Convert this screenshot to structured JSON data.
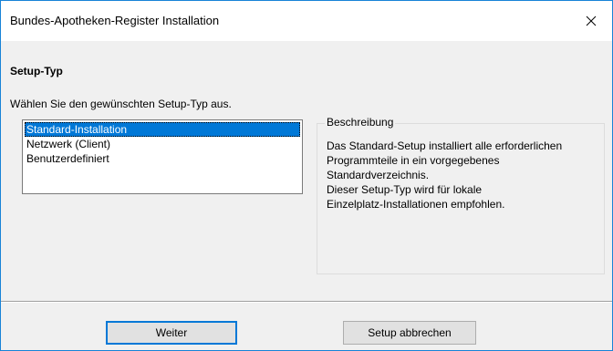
{
  "window": {
    "title": "Bundes-Apotheken-Register Installation"
  },
  "page": {
    "heading": "Setup-Typ",
    "instruction": "Wählen Sie den gewünschten Setup-Typ aus."
  },
  "setup_types": {
    "items": [
      {
        "label": "Standard-Installation",
        "selected": true
      },
      {
        "label": "Netzwerk (Client)",
        "selected": false
      },
      {
        "label": "Benutzerdefiniert",
        "selected": false
      }
    ]
  },
  "description": {
    "legend": "Beschreibung",
    "lines": [
      "Das Standard-Setup installiert alle erforderlichen",
      "Programmteile in ein vorgegebenes",
      "Standardverzeichnis.",
      "Dieser Setup-Typ wird für lokale",
      "Einzelplatz-Installationen empfohlen."
    ]
  },
  "buttons": {
    "next_label": "Weiter",
    "cancel_label": "Setup abbrechen"
  },
  "icons": {
    "close": "close-icon"
  },
  "colors": {
    "selection": "#0078d7",
    "window_border": "#1883d7",
    "dialog_background": "#f0f0f0"
  }
}
